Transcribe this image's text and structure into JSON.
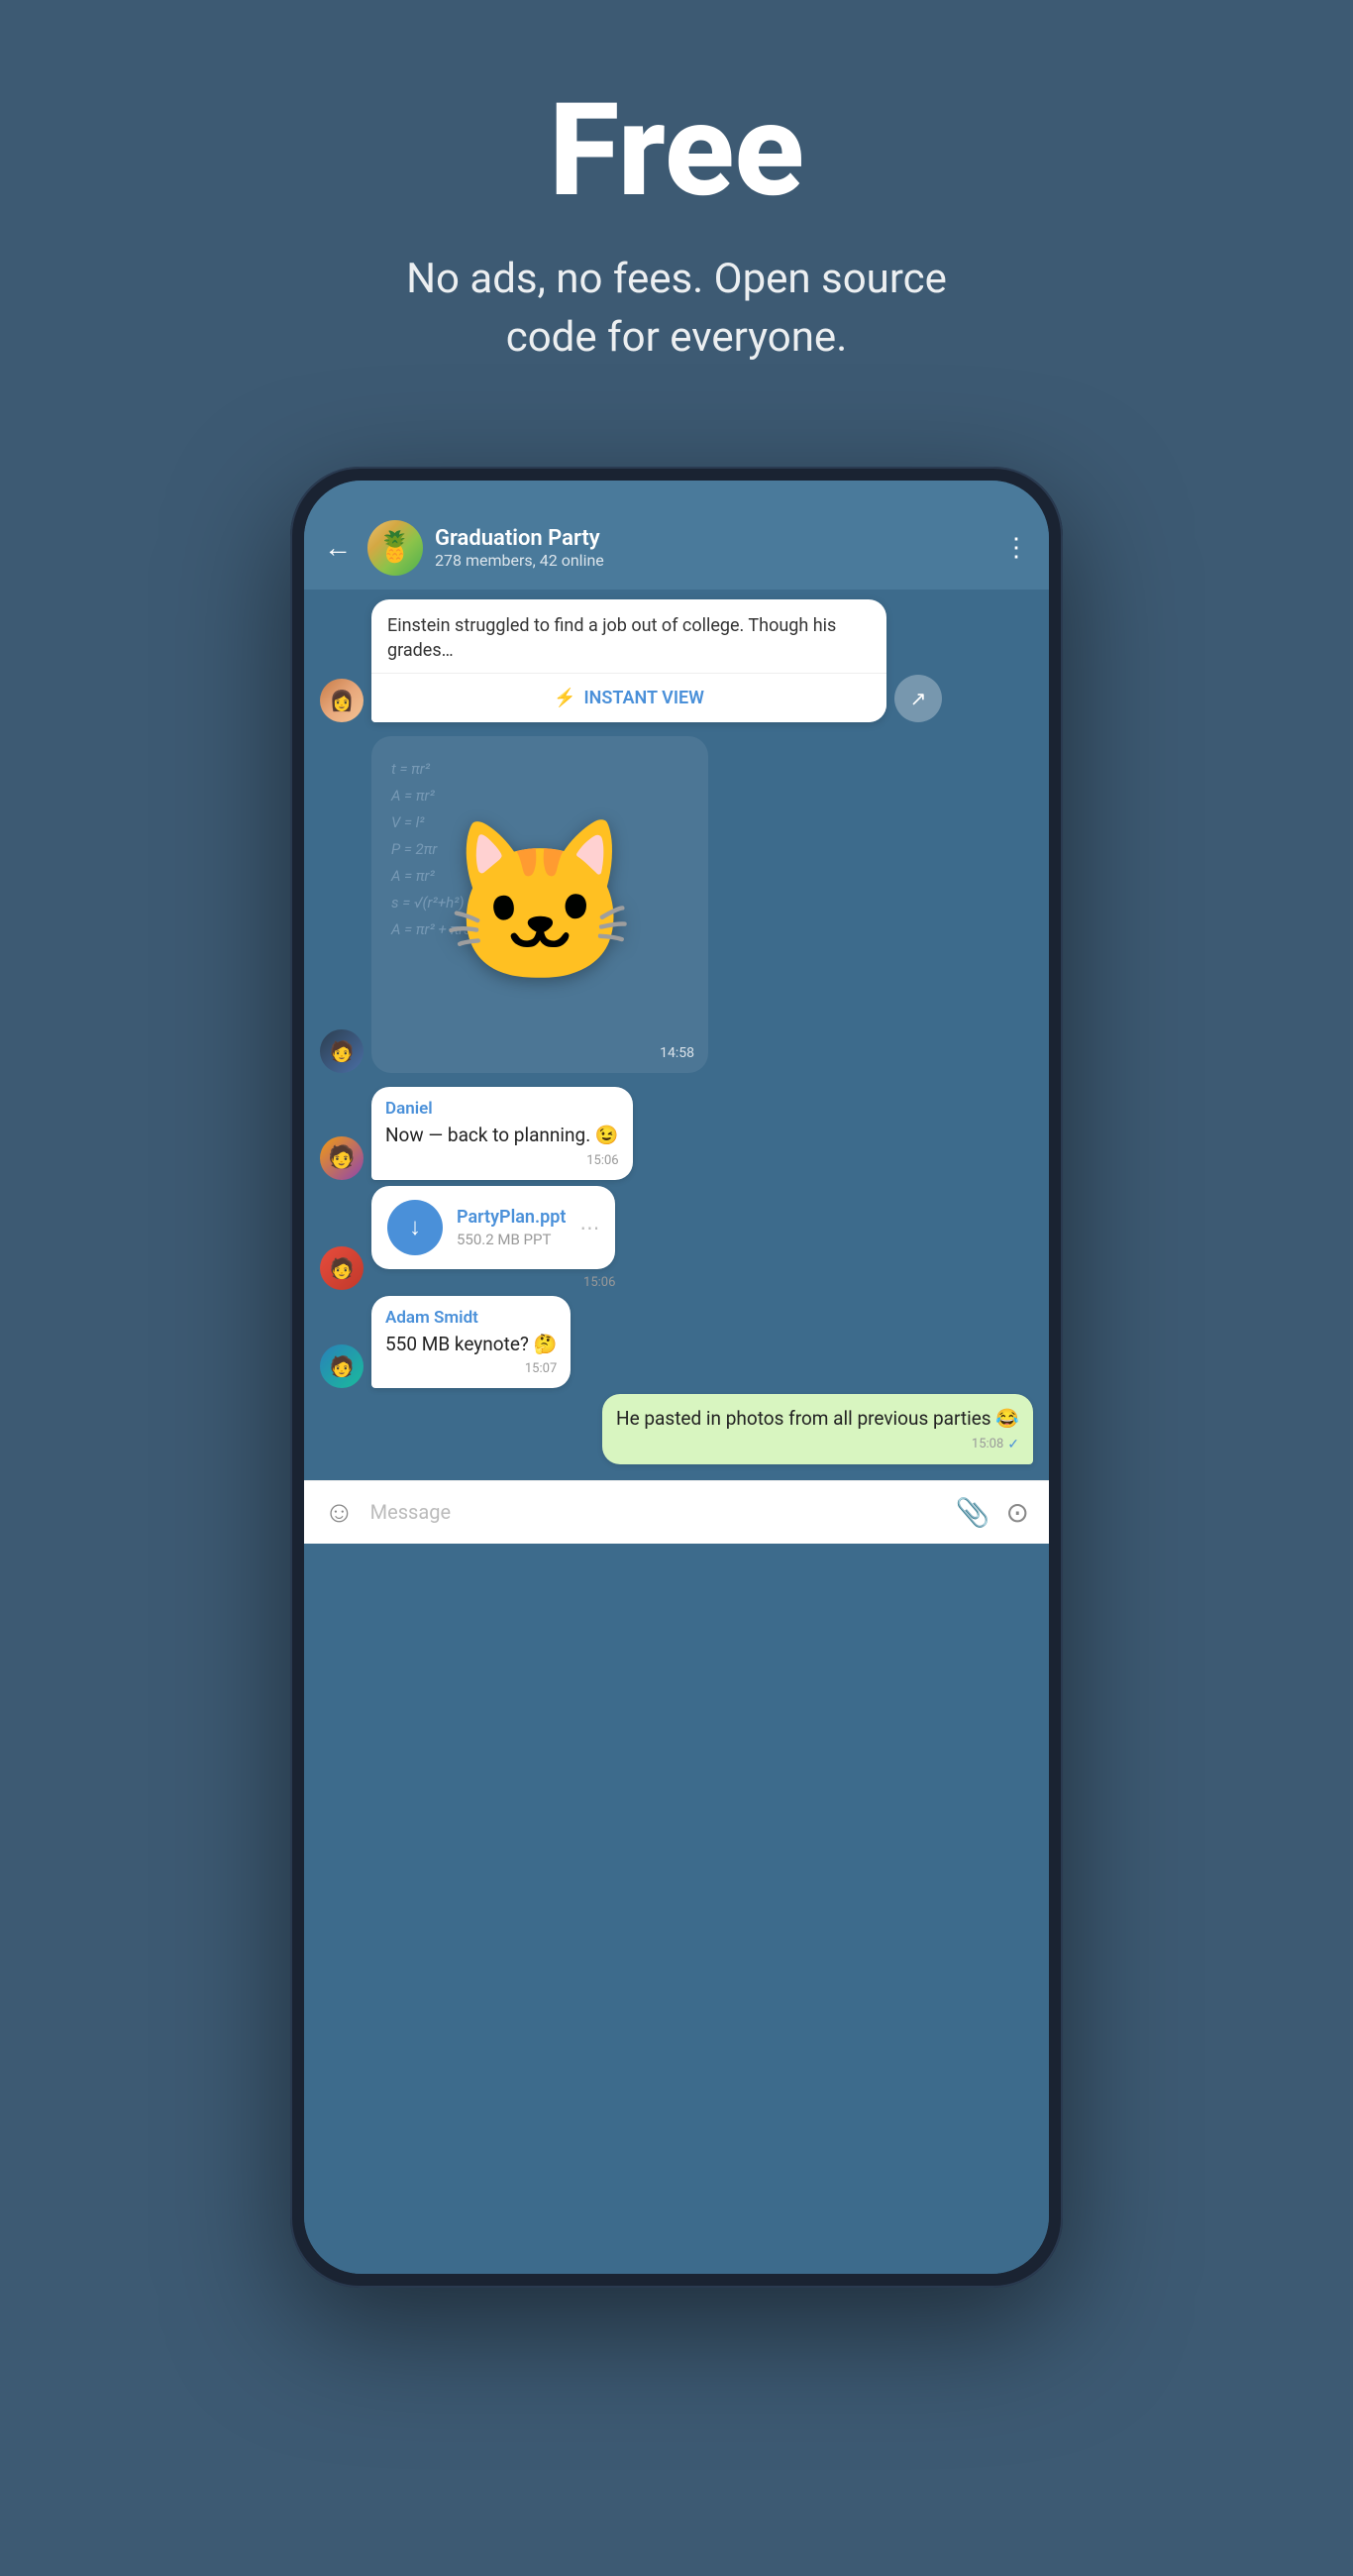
{
  "hero": {
    "title": "Free",
    "subtitle": "No ads, no fees. Open source\ncode for everyone."
  },
  "chat": {
    "group_name": "Graduation Party",
    "group_meta": "278 members, 42 online",
    "back_label": "←",
    "more_label": "⋮"
  },
  "messages": {
    "article_text": "Einstein struggled to find a job out of college. Though his grades…",
    "instant_view_label": "INSTANT VIEW",
    "sticker_time": "14:58",
    "daniel_name": "Daniel",
    "daniel_text": "Now — back to planning. 😉",
    "daniel_time": "15:06",
    "file_name": "PartyPlan.ppt",
    "file_size": "550.2 MB PPT",
    "file_time": "15:06",
    "adam_name": "Adam Smidt",
    "adam_text": "550 MB keynote? 🤔",
    "adam_time": "15:07",
    "outgoing_text": "He pasted in photos from all previous parties 😂",
    "outgoing_time": "15:08"
  },
  "input_bar": {
    "placeholder": "Message"
  }
}
